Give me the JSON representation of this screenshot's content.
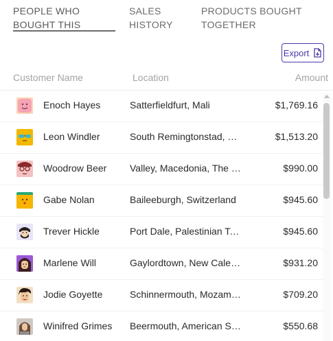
{
  "tabs": [
    {
      "label": "PEOPLE WHO BOUGHT THIS",
      "active": true
    },
    {
      "label": "SALES HISTORY",
      "active": false
    },
    {
      "label": "PRODUCTS BOUGHT TOGETHER",
      "active": false
    }
  ],
  "toolbar": {
    "export_label": "Export",
    "export_icon": "file-export-icon"
  },
  "columns": {
    "name": "Customer Name",
    "location": "Location",
    "amount": "Amount"
  },
  "rows": [
    {
      "name": "Enoch Hayes",
      "location": "Satterfieldfurt, Mali",
      "amount": "$1,769.16",
      "avatar": "pink-face"
    },
    {
      "name": "Leon Windler",
      "location": "South Remingtonstad, Mozambique",
      "amount": "$1,513.20",
      "avatar": "sunglasses-face"
    },
    {
      "name": "Woodrow Beer",
      "location": "Valley, Macedonia, The Former Yugoslav Republic",
      "amount": "$990.00",
      "avatar": "glasses-face"
    },
    {
      "name": "Gabe Nolan",
      "location": "Baileeburgh, Switzerland",
      "amount": "$945.60",
      "avatar": "yellow-face"
    },
    {
      "name": "Trever Hickle",
      "location": "Port Dale, Palestinian Territory",
      "amount": "$945.60",
      "avatar": "beard-face"
    },
    {
      "name": "Marlene Will",
      "location": "Gaylordtown, New Caledonia",
      "amount": "$931.20",
      "avatar": "purple-hair-face"
    },
    {
      "name": "Jodie Goyette",
      "location": "Schinnermouth, Mozambique",
      "amount": "$709.20",
      "avatar": "dark-hair-face"
    },
    {
      "name": "Winifred Grimes",
      "location": "Beermouth, American Samoa",
      "amount": "$550.68",
      "avatar": "photo-face"
    }
  ],
  "colors": {
    "accent": "#4a3aa8",
    "header_text": "#a3a3a3",
    "tab_indicator": "#6b6b6b"
  }
}
